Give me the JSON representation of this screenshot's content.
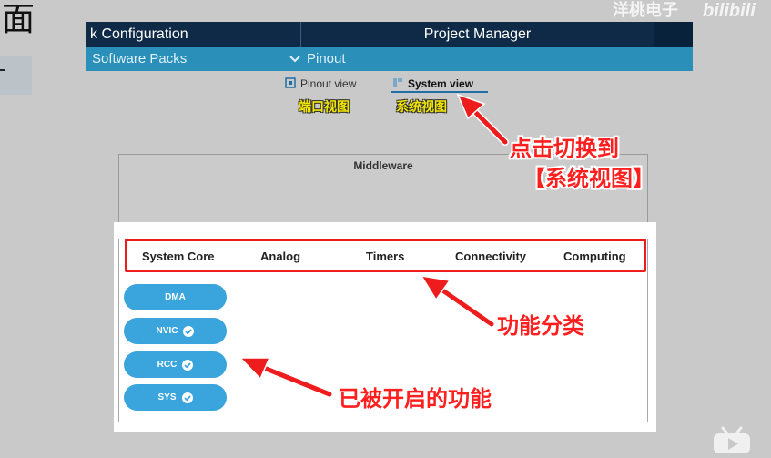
{
  "overlay": {
    "left_glyph": "面"
  },
  "header": {
    "tab_clock_label": "k Configuration",
    "tab_project_label": "Project Manager"
  },
  "subbar": {
    "packs_label": "Software Packs",
    "pinout_label": "Pinout"
  },
  "views": {
    "pinout_label": "Pinout view",
    "system_label": "System view",
    "pinout_annotation": "端口视图",
    "system_annotation": "系统视图"
  },
  "middleware": {
    "title": "Middleware"
  },
  "categories": [
    "System Core",
    "Analog",
    "Timers",
    "Connectivity",
    "Computing"
  ],
  "system_core_items": [
    {
      "label": "DMA",
      "enabled": false
    },
    {
      "label": "NVIC",
      "enabled": true
    },
    {
      "label": "RCC",
      "enabled": true
    },
    {
      "label": "SYS",
      "enabled": true
    }
  ],
  "callouts": {
    "switch_line1": "点击切换到",
    "switch_line2": "【系统视图】",
    "category": "功能分类",
    "enabled": "已被开启的功能"
  },
  "watermark": {
    "text": "洋桃电子",
    "logo": "bilibili"
  },
  "colors": {
    "header_bg": "#0f2a46",
    "subbar_bg": "#2a8fb9",
    "pill_bg": "#3aa4dc",
    "annotation_red": "#ee1c1c",
    "annotation_yellow": "#f2e600"
  },
  "icons": [
    "chevron-down-icon",
    "pinout-view-icon",
    "system-view-icon",
    "check-icon",
    "arrow-icon",
    "tv-icon"
  ]
}
